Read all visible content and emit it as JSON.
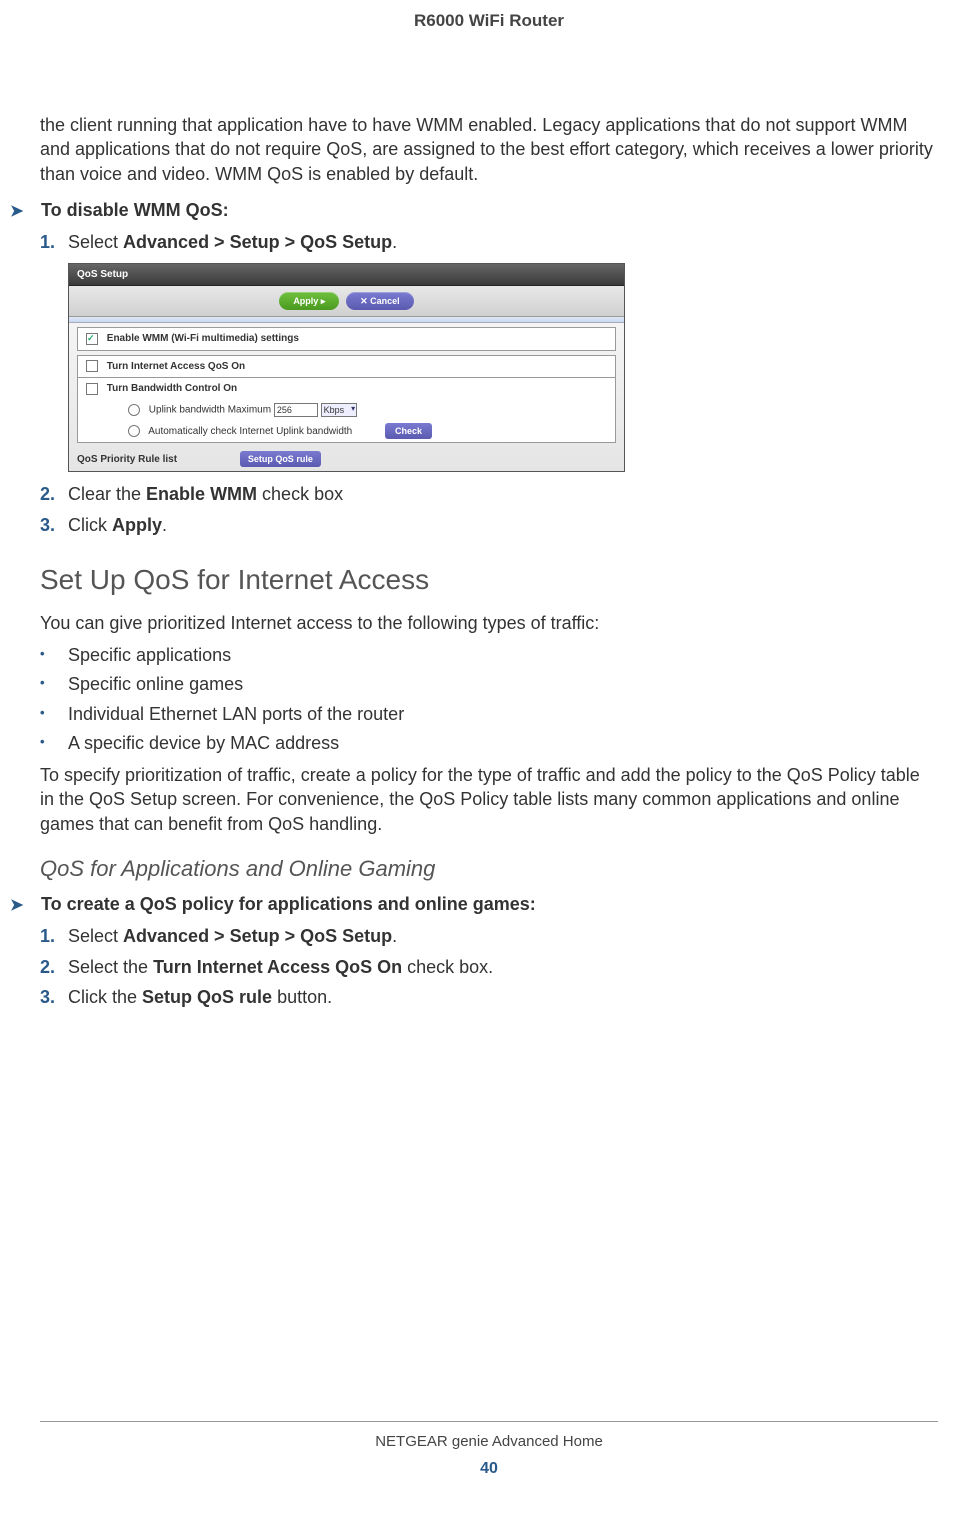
{
  "header": "R6000 WiFi Router",
  "intro": "the client running that application have to have WMM enabled. Legacy applications that do not support WMM and applications that do not require QoS, are assigned to the best effort category, which receives a lower priority than voice and video. WMM QoS is enabled by default.",
  "proc1": {
    "heading": "To disable WMM QoS:",
    "steps": {
      "s1num": "1.",
      "s1a": "Select ",
      "s1b": "Advanced > Setup > QoS Setup",
      "s1c": ".",
      "s2num": "2.",
      "s2a": "Clear the ",
      "s2b": "Enable WMM",
      "s2c": " check box",
      "s3num": "3.",
      "s3a": "Click ",
      "s3b": "Apply",
      "s3c": "."
    }
  },
  "screenshot": {
    "title": "QoS Setup",
    "apply": "Apply ▸",
    "cancel": "✕ Cancel",
    "enable_wmm": "Enable WMM (Wi-Fi multimedia) settings",
    "turn_internet": "Turn Internet Access QoS On",
    "turn_bw": "Turn Bandwidth Control On",
    "uplink_label": "Uplink bandwidth Maximum",
    "uplink_value": "256",
    "uplink_unit": "Kbps",
    "auto_check": "Automatically check Internet Uplink bandwidth",
    "check_btn": "Check",
    "rule_list": "QoS Priority Rule list",
    "setup_rule": "Setup QoS rule"
  },
  "section2": {
    "heading": "Set Up QoS for Internet Access",
    "intro": "You can give prioritized Internet access to the following types of traffic:",
    "bullets": {
      "b1": "Specific applications",
      "b2": "Specific online games",
      "b3": "Individual Ethernet LAN ports of the router",
      "b4": "A specific device by MAC address"
    },
    "para": "To specify prioritization of traffic, create a policy for the type of traffic and add the policy to the QoS Policy table in the QoS Setup screen. For convenience, the QoS Policy table lists many common applications and online games that can benefit from QoS handling."
  },
  "section3": {
    "heading": "QoS for Applications and Online Gaming"
  },
  "proc2": {
    "heading": "To create a QoS policy for applications and online games:",
    "steps": {
      "s1num": "1.",
      "s1a": "Select ",
      "s1b": "Advanced > Setup > QoS Setup",
      "s1c": ".",
      "s2num": "2.",
      "s2a": "Select the ",
      "s2b": "Turn Internet Access QoS On",
      "s2c": " check box.",
      "s3num": "3.",
      "s3a": "Click the ",
      "s3b": "Setup QoS rule",
      "s3c": " button."
    }
  },
  "footer": {
    "text": "NETGEAR genie Advanced Home",
    "page": "40"
  }
}
